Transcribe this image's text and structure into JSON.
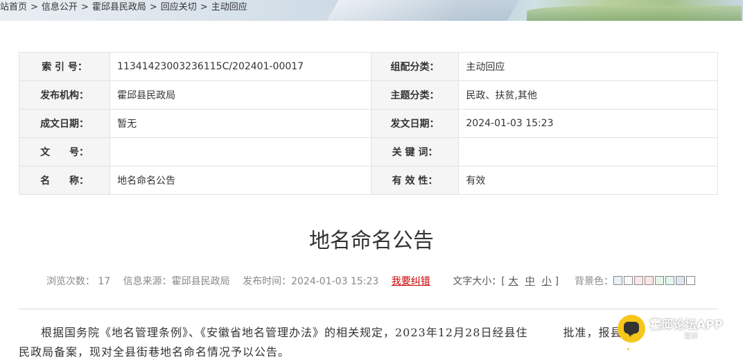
{
  "breadcrumb": {
    "items": [
      "站首页",
      "信息公开",
      "霍邱县民政局",
      "回应关切",
      "主动回应"
    ],
    "sep": ">"
  },
  "meta": {
    "rows": [
      {
        "l1": "索 引 号：",
        "v1": "11341423003236115C/202401-00017",
        "l2": "组配分类：",
        "v2": "主动回应"
      },
      {
        "l1": "发布机构：",
        "v1": "霍邱县民政局",
        "l2": "主题分类：",
        "v2": "民政、扶贫,其他"
      },
      {
        "l1": "成文日期：",
        "v1": "暂无",
        "l2": "发文日期：",
        "v2": "2024-01-03 15:23"
      },
      {
        "l1": "文　　号：",
        "v1": "",
        "l2": "关 键 词：",
        "v2": ""
      },
      {
        "l1": "名　　称：",
        "v1": "地名命名公告",
        "l2": "有 效 性：",
        "v2": "有效"
      }
    ]
  },
  "article": {
    "title": "地名命名公告",
    "views_label": "浏览次数：",
    "views": "17",
    "source_label": "信息来源：",
    "source": "霍邱县民政局",
    "time_label": "发布时间：",
    "time": "2024-01-03 15:23",
    "report_error": "我要纠错",
    "font_size_label": "文字大小：[",
    "font_sizes": [
      "大",
      "中",
      "小"
    ],
    "font_size_end": "]",
    "bg_label": "背景色：",
    "bg_colors": [
      "#e8f0f8",
      "#f7f7f7",
      "#fbe9e7",
      "#fde4e4",
      "#e8f5e9",
      "#e0f7f0",
      "#dfe6ee",
      "#ffffff"
    ],
    "body_line1": "根据国务院《地名管理条例》、《安徽省地名管理办法》的相关规定，2023年12月28日经县住　　　批准，报县",
    "body_line2": "民政局备案，现对全县街巷地名命名情况予以公告。"
  },
  "app_badge": {
    "title": "霍邱论坛APP",
    "sub": "霍邱"
  }
}
